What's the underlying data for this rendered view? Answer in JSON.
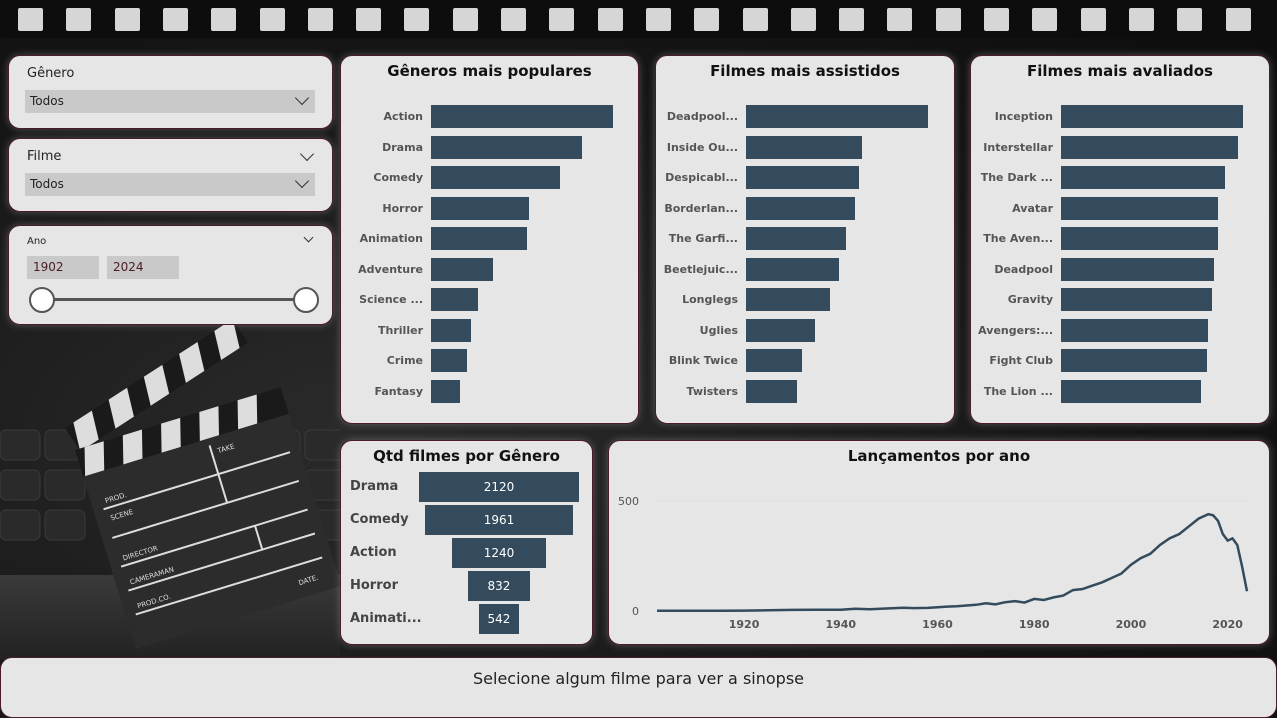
{
  "filters": {
    "genero": {
      "label": "Gênero",
      "value": "Todos"
    },
    "filme": {
      "label": "Filme",
      "value": "Todos"
    },
    "ano": {
      "label": "Ano",
      "start": "1902",
      "end": "2024"
    }
  },
  "sinopse_text": "Selecione algum filme para ver a sinopse",
  "chart_data": [
    {
      "type": "bar",
      "orientation": "horizontal",
      "title": "Gêneros mais populares",
      "categories": [
        "Action",
        "Drama",
        "Comedy",
        "Horror",
        "Animation",
        "Adventure",
        "Science ...",
        "Thriller",
        "Crime",
        "Fantasy"
      ],
      "values": [
        100,
        83,
        71,
        54,
        53,
        34,
        26,
        22,
        20,
        16
      ]
    },
    {
      "type": "bar",
      "orientation": "horizontal",
      "title": "Filmes mais assistidos",
      "categories": [
        "Deadpool...",
        "Inside Ou...",
        "Despicabl...",
        "Borderlan...",
        "The Garfi...",
        "Beetlejuic...",
        "Longlegs",
        "Uglies",
        "Blink Twice",
        "Twisters"
      ],
      "values": [
        100,
        64,
        62,
        60,
        55,
        51,
        46,
        38,
        31,
        28
      ]
    },
    {
      "type": "bar",
      "orientation": "horizontal",
      "title": "Filmes mais avaliados",
      "categories": [
        "Inception",
        "Interstellar",
        "The Dark ...",
        "Avatar",
        "The Aven...",
        "Deadpool",
        "Gravity",
        "Avengers:...",
        "Fight Club",
        "The Lion ..."
      ],
      "values": [
        100,
        97,
        90,
        86,
        86,
        84,
        83,
        81,
        80,
        77
      ]
    },
    {
      "type": "bar",
      "orientation": "funnel",
      "title": "Qtd filmes por Gênero",
      "categories": [
        "Drama",
        "Comedy",
        "Action",
        "Horror",
        "Animati..."
      ],
      "values": [
        2120,
        1961,
        1240,
        832,
        542
      ]
    },
    {
      "type": "line",
      "title": "Lançamentos por ano",
      "ylim": [
        0,
        500
      ],
      "yticks": [
        0,
        500
      ],
      "xticks": [
        1920,
        1940,
        1960,
        1980,
        2000,
        2020
      ],
      "xlim": [
        1902,
        2024
      ],
      "points": [
        [
          1902,
          1
        ],
        [
          1905,
          1
        ],
        [
          1910,
          1
        ],
        [
          1915,
          1
        ],
        [
          1920,
          2
        ],
        [
          1925,
          3
        ],
        [
          1930,
          5
        ],
        [
          1935,
          6
        ],
        [
          1940,
          6
        ],
        [
          1943,
          10
        ],
        [
          1946,
          8
        ],
        [
          1950,
          12
        ],
        [
          1953,
          15
        ],
        [
          1955,
          13
        ],
        [
          1958,
          14
        ],
        [
          1960,
          17
        ],
        [
          1962,
          20
        ],
        [
          1964,
          22
        ],
        [
          1966,
          25
        ],
        [
          1968,
          28
        ],
        [
          1970,
          35
        ],
        [
          1972,
          30
        ],
        [
          1974,
          40
        ],
        [
          1976,
          45
        ],
        [
          1978,
          38
        ],
        [
          1980,
          55
        ],
        [
          1982,
          50
        ],
        [
          1984,
          62
        ],
        [
          1986,
          70
        ],
        [
          1988,
          95
        ],
        [
          1990,
          100
        ],
        [
          1992,
          115
        ],
        [
          1994,
          130
        ],
        [
          1996,
          150
        ],
        [
          1998,
          170
        ],
        [
          2000,
          210
        ],
        [
          2002,
          240
        ],
        [
          2004,
          260
        ],
        [
          2006,
          300
        ],
        [
          2008,
          330
        ],
        [
          2010,
          350
        ],
        [
          2012,
          385
        ],
        [
          2014,
          420
        ],
        [
          2016,
          440
        ],
        [
          2017,
          435
        ],
        [
          2018,
          410
        ],
        [
          2019,
          350
        ],
        [
          2020,
          320
        ],
        [
          2021,
          330
        ],
        [
          2022,
          300
        ],
        [
          2023,
          200
        ],
        [
          2024,
          90
        ]
      ]
    }
  ]
}
